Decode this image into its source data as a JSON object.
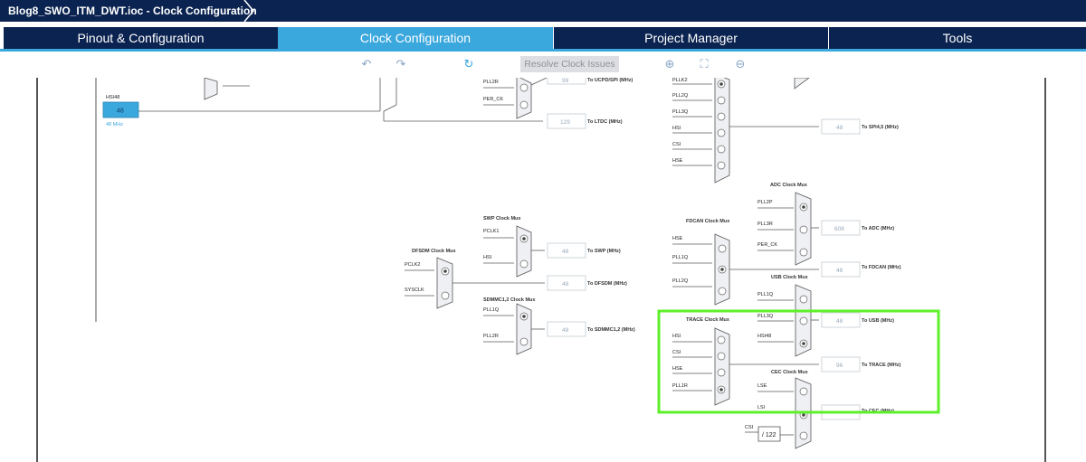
{
  "window": {
    "title": "Blog8_SWO_ITM_DWT.ioc - Clock Configuration"
  },
  "tabs": [
    {
      "label": "Pinout & Configuration"
    },
    {
      "label": "Clock Configuration"
    },
    {
      "label": "Project Manager"
    },
    {
      "label": "Tools"
    }
  ],
  "toolbar": {
    "resolve_label": "Resolve Clock Issues"
  },
  "diagram": {
    "hsi48": {
      "label": "HSI48",
      "value": "48",
      "freq": "48 MHz"
    },
    "top_mux": {
      "inputs": [
        "PLL2R",
        "PER_CK"
      ]
    },
    "outputs": {
      "ucpd": {
        "value": "99",
        "dest": "To UCPD/SPI (MHz)"
      },
      "ltdc": {
        "value": "129",
        "dest": "To LTDC (MHz)"
      },
      "spi45": {
        "value": "48",
        "dest": "To SPI4,5 (MHz)"
      },
      "swp": {
        "value": "48",
        "dest": "To SWP (MHz)"
      },
      "dfsdm": {
        "value": "48",
        "dest": "To DFSDM (MHz)"
      },
      "sdmmc": {
        "value": "48",
        "dest": "To SDMMC1,2 (MHz)"
      },
      "adc": {
        "value": "608",
        "dest": "To ADC (MHz)"
      },
      "fdcan": {
        "value": "48",
        "dest": "To FDCAN (MHz)"
      },
      "usb": {
        "value": "48",
        "dest": "To USB (MHz)"
      },
      "trace": {
        "value": "96",
        "dest": "To TRACE (MHz)"
      },
      "cec": {
        "value": "",
        "dest": "To CEC (MHz)"
      }
    },
    "spi_mux": {
      "inputs": [
        "PLLK2",
        "PLL2Q",
        "PLL3Q",
        "HSI",
        "CSI",
        "HSE"
      ]
    },
    "adc_mux": {
      "title": "ADC Clock Mux",
      "inputs": [
        "PLL2P",
        "PLL3R",
        "PER_CK"
      ]
    },
    "fdcan_mux": {
      "title": "FDCAN Clock Mux",
      "inputs": [
        "HSE",
        "PLL1Q",
        "PLL2Q"
      ]
    },
    "usb_mux": {
      "title": "USB Clock Mux",
      "inputs": [
        "PLL1Q",
        "PLL3Q",
        "HSI48"
      ]
    },
    "trace_mux": {
      "title": "TRACE Clock Mux",
      "inputs": [
        "HSI",
        "CSI",
        "HSE",
        "PLL1R"
      ]
    },
    "cec_mux": {
      "title": "CEC Clock Mux",
      "inputs": [
        "LSE",
        "LSI",
        "CSI"
      ]
    },
    "csi_divider": "/ 122",
    "swp_mux": {
      "title": "SWP Clock Mux",
      "inputs": [
        "PCLK1",
        "HSI"
      ]
    },
    "dfsdm_mux": {
      "title": "DFSDM Clock Mux",
      "inputs": [
        "PCLK2",
        "SYSCLK"
      ]
    },
    "sdmmc_mux": {
      "title": "SDMMC1,2 Clock Mux",
      "inputs": [
        "PLL1Q",
        "PLL2R"
      ]
    }
  },
  "colors": {
    "nav": "#0b2350",
    "accent": "#3aa7dd",
    "highlight": "#5df02a"
  }
}
